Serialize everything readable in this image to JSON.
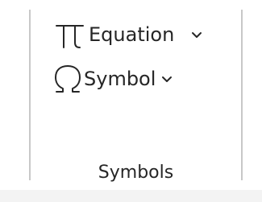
{
  "group": {
    "label": "Symbols"
  },
  "commands": {
    "equation": {
      "label": "Equation",
      "icon": "pi-icon",
      "has_dropdown": true
    },
    "symbol": {
      "label": "Symbol",
      "icon": "omega-icon",
      "has_dropdown": true
    }
  },
  "colors": {
    "text": "#262626",
    "divider": "#c8c8c8",
    "background": "#ffffff",
    "bottom_strip": "#f3f3f3"
  }
}
